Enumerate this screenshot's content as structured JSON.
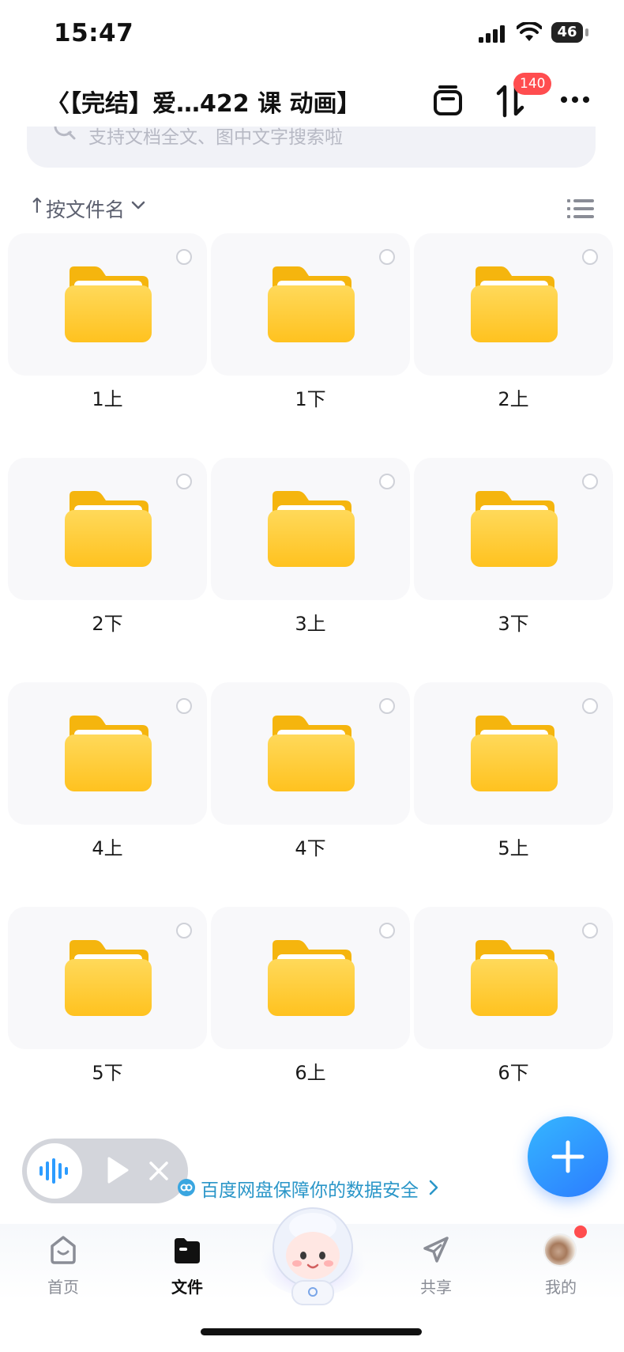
{
  "status_bar": {
    "time": "15:47",
    "battery": "46"
  },
  "header": {
    "title": "〈【完结】爱…422 课 动画】",
    "transfer_badge": "140"
  },
  "search": {
    "placeholder": "支持文档全文、图中文字搜索啦"
  },
  "sort": {
    "arrow": "↑",
    "label": "按文件名"
  },
  "folders": [
    {
      "name": "1上"
    },
    {
      "name": "1下"
    },
    {
      "name": "2上"
    },
    {
      "name": "2下"
    },
    {
      "name": "3上"
    },
    {
      "name": "3下"
    },
    {
      "name": "4上"
    },
    {
      "name": "4下"
    },
    {
      "name": "5上"
    },
    {
      "name": "5下"
    },
    {
      "name": "6上"
    },
    {
      "name": "6下"
    }
  ],
  "promo": {
    "text": "百度网盘保障你的数据安全"
  },
  "bottom_nav": {
    "items": [
      {
        "label": "首页"
      },
      {
        "label": "文件"
      },
      {
        "label": "共享"
      },
      {
        "label": "我的"
      }
    ]
  },
  "colors": {
    "accent": "#2c7cff",
    "folder": "#ffc83d",
    "badge": "#ff4d4f",
    "promo": "#2a96c8"
  }
}
